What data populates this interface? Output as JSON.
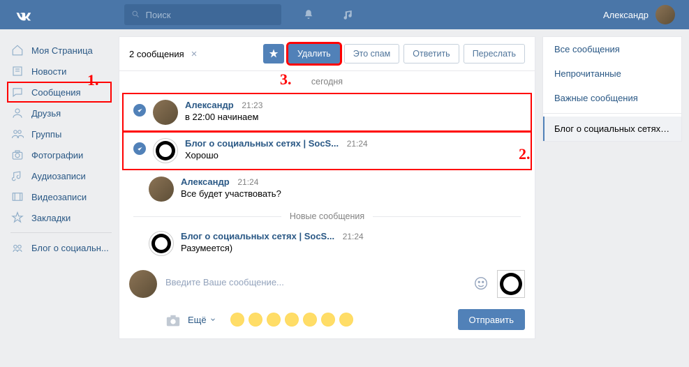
{
  "header": {
    "search_placeholder": "Поиск",
    "user_name": "Александр"
  },
  "sidebar": {
    "items": [
      {
        "id": "my-page",
        "label": "Моя Страница"
      },
      {
        "id": "news",
        "label": "Новости"
      },
      {
        "id": "messages",
        "label": "Сообщения"
      },
      {
        "id": "friends",
        "label": "Друзья"
      },
      {
        "id": "groups",
        "label": "Группы"
      },
      {
        "id": "photos",
        "label": "Фотографии"
      },
      {
        "id": "audio",
        "label": "Аудиозаписи"
      },
      {
        "id": "video",
        "label": "Видеозаписи"
      },
      {
        "id": "bookmarks",
        "label": "Закладки"
      }
    ],
    "blog_label": "Блог о социальн..."
  },
  "chat": {
    "selection_count": "2 сообщения",
    "actions": {
      "delete": "Удалить",
      "spam": "Это спам",
      "reply": "Ответить",
      "forward": "Переслать"
    },
    "date_separator": "сегодня",
    "new_separator": "Новые сообщения",
    "messages": [
      {
        "from": "Александр",
        "time": "21:23",
        "text": "в 22:00 начинаем"
      },
      {
        "from": "Блог о социальных сетях | SocS...",
        "time": "21:24",
        "text": "Хорошо"
      },
      {
        "from": "Александр",
        "time": "21:24",
        "text": "Все будет участвовать?"
      },
      {
        "from": "Блог о социальных сетях | SocS...",
        "time": "21:24",
        "text": "Разумеется)"
      }
    ],
    "compose": {
      "placeholder": "Введите Ваше сообщение...",
      "attach_more": "Ещё",
      "send": "Отправить"
    }
  },
  "right": {
    "items": [
      {
        "id": "all",
        "label": "Все сообщения"
      },
      {
        "id": "unread",
        "label": "Непрочитанные"
      },
      {
        "id": "important",
        "label": "Важные сообщения"
      }
    ],
    "active_chat": "Блог о социальных сетях | ..."
  },
  "annotations": {
    "a1": "1.",
    "a2": "2.",
    "a3": "3."
  }
}
